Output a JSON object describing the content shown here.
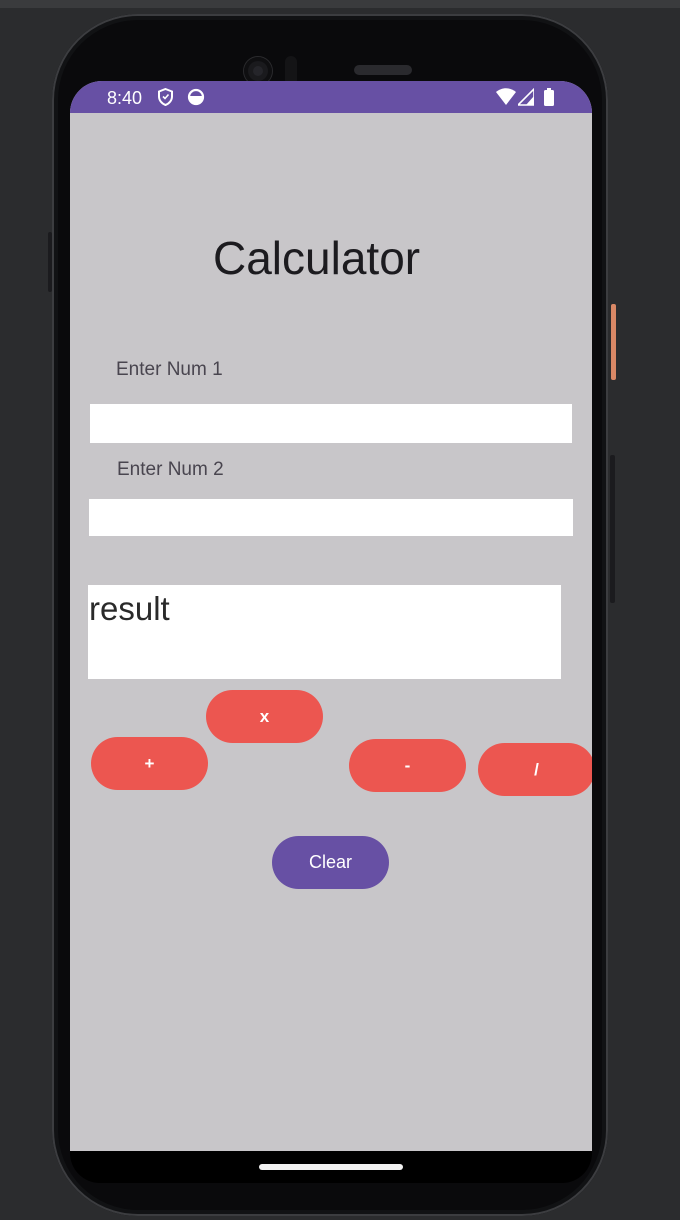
{
  "status_bar": {
    "time": "8:40",
    "icons": [
      "shield-icon",
      "data-saver-icon",
      "wifi-icon",
      "signal-icon",
      "battery-icon"
    ],
    "color": "#6750a4"
  },
  "app": {
    "title": "Calculator",
    "num1_label": "Enter Num 1",
    "num1_value": "",
    "num2_label": "Enter Num 2",
    "num2_value": "",
    "result_text": "result"
  },
  "buttons": {
    "multiply": "x",
    "add": "+",
    "subtract": "-",
    "divide": "/",
    "clear": "Clear"
  },
  "colors": {
    "background": "#c8c6c9",
    "operator_button": "#ec5650",
    "clear_button": "#6750a4",
    "field": "#ffffff"
  }
}
